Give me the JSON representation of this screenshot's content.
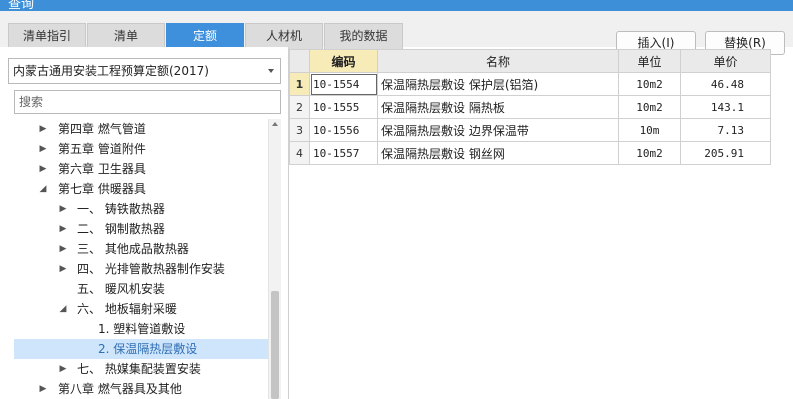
{
  "window": {
    "title": "查询"
  },
  "tabs": [
    {
      "label": "清单指引",
      "active": false
    },
    {
      "label": "清单",
      "active": false
    },
    {
      "label": "定额",
      "active": true
    },
    {
      "label": "人材机",
      "active": false
    },
    {
      "label": "我的数据",
      "active": false
    }
  ],
  "buttons": {
    "insert": "插入(I)",
    "replace": "替换(R)"
  },
  "library_select": {
    "value": "内蒙古通用安装工程预算定额(2017)"
  },
  "search": {
    "placeholder": "搜索",
    "value": ""
  },
  "tree": [
    {
      "label": "第四章 燃气管道",
      "arrow": "right"
    },
    {
      "label": "第五章 管道附件",
      "arrow": "right"
    },
    {
      "label": "第六章 卫生器具",
      "arrow": "right"
    },
    {
      "label": "第七章 供暖器具",
      "arrow": "down"
    },
    {
      "label": "一、 铸铁散热器",
      "arrow": "right"
    },
    {
      "label": "二、 钢制散热器",
      "arrow": "right"
    },
    {
      "label": "三、 其他成品散热器",
      "arrow": "right"
    },
    {
      "label": "四、 光排管散热器制作安装",
      "arrow": "right"
    },
    {
      "label": "五、 暖风机安装",
      "arrow": "none"
    },
    {
      "label": "六、 地板辐射采暖",
      "arrow": "down"
    },
    {
      "label": "1. 塑料管道敷设",
      "arrow": "none"
    },
    {
      "label": "2. 保温隔热层敷设",
      "arrow": "none",
      "selected": true
    },
    {
      "label": "七、 热媒集配装置安装",
      "arrow": "right"
    },
    {
      "label": "第八章 燃气器具及其他",
      "arrow": "right"
    }
  ],
  "table": {
    "columns": [
      "编码",
      "名称",
      "单位",
      "单价"
    ],
    "rows": [
      {
        "num": "1",
        "code": "10-1554",
        "name": "保温隔热层敷设 保护层(铝箔)",
        "unit": "10m2",
        "price": "46.48"
      },
      {
        "num": "2",
        "code": "10-1555",
        "name": "保温隔热层敷设 隔热板",
        "unit": "10m2",
        "price": "143.1"
      },
      {
        "num": "3",
        "code": "10-1556",
        "name": "保温隔热层敷设 边界保温带",
        "unit": "10m",
        "price": "7.13"
      },
      {
        "num": "4",
        "code": "10-1557",
        "name": "保温隔热层敷设 钢丝网",
        "unit": "10m2",
        "price": "205.91"
      }
    ]
  },
  "colors": {
    "accent": "#3e90dc",
    "selection": "#cfe5fb",
    "header_highlight": "#f7ebb8"
  }
}
